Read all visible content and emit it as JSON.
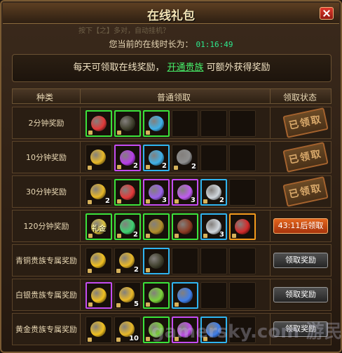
{
  "window": {
    "title": "在线礼包"
  },
  "marquee": "按下【之】多对，自动挂机？",
  "online": {
    "label": "您当前的在线时长为：",
    "time": "01:16:49"
  },
  "notice": {
    "text_before": "每天可领取在线奖励，",
    "link": "开通贵族",
    "text_after": "可额外获得奖励"
  },
  "table": {
    "headers": {
      "category": "种类",
      "normal": "普通领取",
      "status": "领取状态"
    },
    "rows": [
      {
        "category": "2分钟奖励",
        "status_type": "stamp",
        "status_text": "已领取",
        "items": [
          {
            "q": "green",
            "color": "#e23a3a",
            "count": "",
            "lock": true
          },
          {
            "q": "green",
            "color": "#3f3f2c",
            "count": "",
            "lock": true
          },
          {
            "q": "green",
            "color": "#3fb0e8",
            "count": "",
            "lock": true
          }
        ]
      },
      {
        "category": "10分钟奖励",
        "status_type": "stamp",
        "status_text": "已领取",
        "items": [
          {
            "q": "",
            "color": "#e8b828",
            "count": "",
            "lock": true
          },
          {
            "q": "purple",
            "color": "#b63ee8",
            "count": "2",
            "lock": true
          },
          {
            "q": "blue",
            "color": "#3fb0e8",
            "count": "2",
            "lock": true
          },
          {
            "q": "",
            "color": "#8e8e8e",
            "count": "2",
            "lock": true
          }
        ]
      },
      {
        "category": "30分钟奖励",
        "status_type": "stamp",
        "status_text": "已领取",
        "items": [
          {
            "q": "",
            "color": "#e8b828",
            "count": "2",
            "lock": true
          },
          {
            "q": "green",
            "color": "#e23a3a",
            "count": "",
            "lock": true
          },
          {
            "q": "purple",
            "color": "#9a62e8",
            "count": "3",
            "lock": true
          },
          {
            "q": "purple",
            "color": "#c05cf0",
            "count": "3",
            "lock": true
          },
          {
            "q": "blue",
            "color": "#d0d6dc",
            "count": "2",
            "lock": true
          }
        ]
      },
      {
        "category": "120分钟奖励",
        "status_type": "timer",
        "status_text": "43:11后领取",
        "items": [
          {
            "q": "green",
            "color": "#d8c040",
            "count": "",
            "lock": true,
            "tag": "礼金"
          },
          {
            "q": "green",
            "color": "#3fd070",
            "count": "2",
            "lock": true
          },
          {
            "q": "green",
            "color": "#b08c2a",
            "count": "",
            "lock": true
          },
          {
            "q": "green",
            "color": "#8a3a22",
            "count": "",
            "lock": true
          },
          {
            "q": "blue",
            "color": "#d0d6dc",
            "count": "3",
            "lock": true
          },
          {
            "q": "orange",
            "color": "#d22a2a",
            "count": "",
            "lock": true
          }
        ]
      },
      {
        "category": "青铜贵族专属奖励",
        "status_type": "button",
        "status_text": "领取奖励",
        "items": [
          {
            "q": "",
            "color": "#f0c020",
            "count": "",
            "lock": true
          },
          {
            "q": "",
            "color": "#e8b828",
            "count": "2",
            "lock": true
          },
          {
            "q": "blue",
            "color": "#3f3f2c",
            "count": "",
            "lock": true
          }
        ]
      },
      {
        "category": "白银贵族专属奖励",
        "status_type": "button",
        "status_text": "领取奖励",
        "items": [
          {
            "q": "purple",
            "color": "#f0c020",
            "count": "",
            "lock": true
          },
          {
            "q": "",
            "color": "#e8b828",
            "count": "5",
            "lock": true
          },
          {
            "q": "green",
            "color": "#7ad03a",
            "count": "",
            "lock": true
          },
          {
            "q": "blue",
            "color": "#3f7ee8",
            "count": "",
            "lock": true
          }
        ]
      },
      {
        "category": "黄金贵族专属奖励",
        "status_type": "button",
        "status_text": "领取奖励",
        "items": [
          {
            "q": "",
            "color": "#f0c020",
            "count": "",
            "lock": true
          },
          {
            "q": "",
            "color": "#e8b828",
            "count": "10",
            "lock": true
          },
          {
            "q": "green",
            "color": "#7ad03a",
            "count": "",
            "lock": true
          },
          {
            "q": "purple",
            "color": "#c04ce8",
            "count": "",
            "lock": true
          },
          {
            "q": "blue",
            "color": "#3f7ee8",
            "count": "",
            "lock": true
          }
        ]
      }
    ]
  },
  "watermark": "gamersky.com 游民网"
}
